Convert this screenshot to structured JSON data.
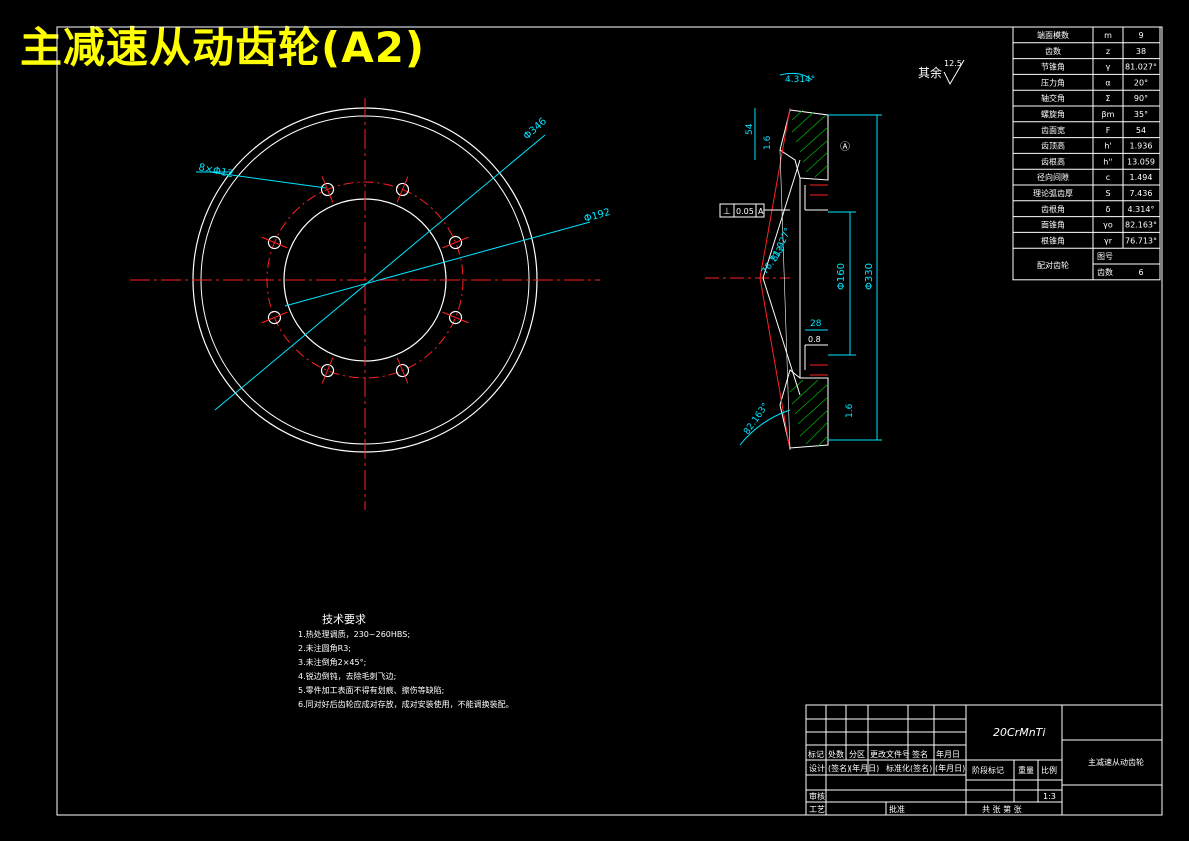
{
  "title": "主减速从动齿轮(A2)",
  "colors": {
    "background": "#000000",
    "title": "#ffff00",
    "outline": "#ffffff",
    "center_line": "#ff0000",
    "dimension": "#00e5ff",
    "hatch": "#00c000"
  },
  "roughness": {
    "label": "其余",
    "value": "12.5"
  },
  "params": [
    {
      "name": "端面模数",
      "sym": "m",
      "val": "9"
    },
    {
      "name": "齿数",
      "sym": "z",
      "val": "38"
    },
    {
      "name": "节锥角",
      "sym": "γ",
      "val": "81.027°"
    },
    {
      "name": "压力角",
      "sym": "α",
      "val": "20°"
    },
    {
      "name": "轴交角",
      "sym": "Σ",
      "val": "90°"
    },
    {
      "name": "螺旋角",
      "sym": "βm",
      "val": "35°"
    },
    {
      "name": "齿面宽",
      "sym": "F",
      "val": "54"
    },
    {
      "name": "齿顶高",
      "sym": "h'",
      "val": "1.936"
    },
    {
      "name": "齿根高",
      "sym": "h''",
      "val": "13.059"
    },
    {
      "name": "径向间隙",
      "sym": "c",
      "val": "1.494"
    },
    {
      "name": "理论弧齿厚",
      "sym": "S",
      "val": "7.436"
    },
    {
      "name": "齿根角",
      "sym": "δ",
      "val": "4.314°"
    },
    {
      "name": "面锥角",
      "sym": "γo",
      "val": "82.163°"
    },
    {
      "name": "根锥角",
      "sym": "γr",
      "val": "76.713°"
    }
  ],
  "mating": {
    "label": "配对齿轮",
    "row1": "图号",
    "row2": "齿数",
    "row2_val": "6"
  },
  "front_dims": {
    "holes": "8×Φ12",
    "d1": "Φ346",
    "d2": "Φ192"
  },
  "side_dims": {
    "angle_top": "4.314°",
    "dim54": "54",
    "r16": "1.6",
    "gdt_symbol": "⊥",
    "gdt_tol": "0.05",
    "gdt_datum": "A",
    "angle_mid": "81.027°",
    "angle_low": "76.713°",
    "d160": "Φ160",
    "d330": "Φ330",
    "dim28": "28",
    "r08": "0.8",
    "r16b": "1.6",
    "angle_bot": "82.163°"
  },
  "tech": {
    "heading": "技术要求",
    "items": [
      "1.热处理调质，230~260HBS;",
      "2.未注圆角R3;",
      "3.未注倒角2×45°;",
      "4.锐边倒钝，去除毛刺飞边;",
      "5.零件加工表面不得有划痕、擦伤等缺陷;",
      "6.同对好后齿轮应成对存放，成对安装使用，不能调换装配。"
    ]
  },
  "titleblock": {
    "material": "20CrMnTi",
    "part_name": "主减速从动齿轮",
    "h": [
      "标记",
      "处数",
      "分区",
      "更改文件号",
      "签名",
      "年月日"
    ],
    "design": "设计",
    "sig1": "(签名)",
    "date1": "(年月日)",
    "std": "标准化",
    "sig2": "(签名)",
    "date2": "(年月日)",
    "stage": "阶段标记",
    "weight": "重量",
    "scale_h": "比例",
    "scale": "1:3",
    "review": "审核",
    "craft": "工艺",
    "approve": "批准",
    "sheets": "共   张   第   张"
  }
}
